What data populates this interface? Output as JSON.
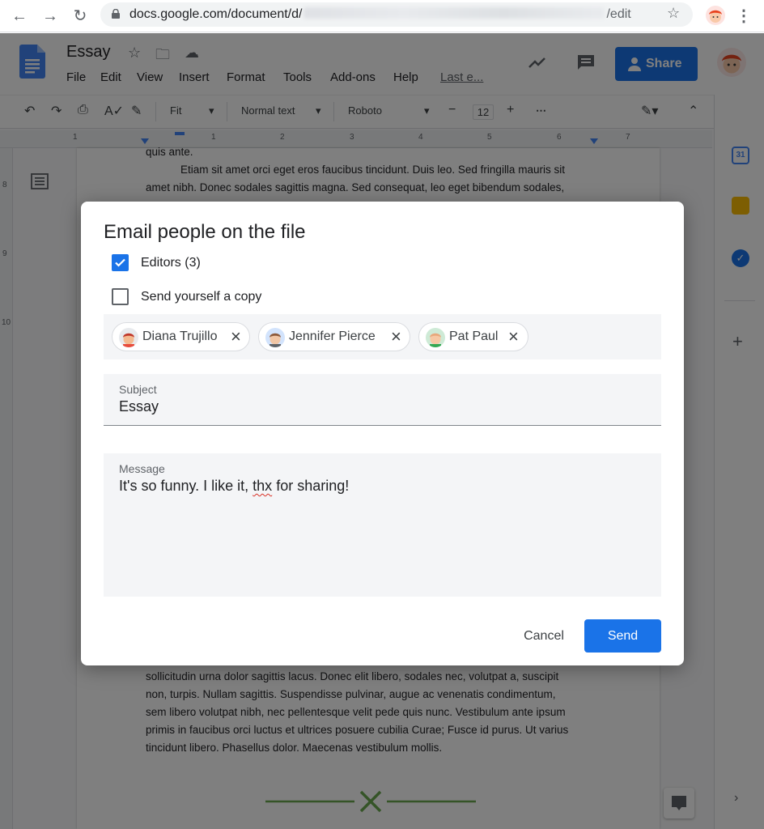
{
  "browser": {
    "url_prefix": "docs.google.com/document/d/",
    "url_suffix": "/edit",
    "back_icon": "arrow-left-icon",
    "forward_icon": "arrow-right-icon",
    "reload_icon": "reload-icon",
    "bookmark_icon": "star-icon",
    "menu_icon": "vertical-dots-icon"
  },
  "doc": {
    "title": "Essay",
    "menu": [
      "File",
      "Edit",
      "View",
      "Insert",
      "Format",
      "Tools",
      "Add-ons",
      "Help"
    ],
    "last_edit": "Last e...",
    "share_label": "Share",
    "toolbar": {
      "zoom": "Fit",
      "style": "Normal text",
      "font": "Roboto",
      "font_size": "12"
    },
    "ruler_numbers": [
      "1",
      "1",
      "2",
      "3",
      "4",
      "5",
      "6",
      "7"
    ],
    "vruler_numbers": [
      "8",
      "9",
      "10"
    ],
    "page_top": [
      "quis ante.",
      "Etiam sit amet orci eget eros faucibus tincidunt. Duis leo. Sed fringilla mauris sit",
      "amet nibh. Donec sodales sagittis magna. Sed consequat, leo eget bibendum sodales,"
    ],
    "page_bottom": [
      "sollicitudin urna dolor sagittis lacus. Donec elit libero, sodales nec, volutpat a, suscipit",
      "non, turpis. Nullam sagittis. Suspendisse pulvinar, augue ac venenatis condimentum,",
      "sem libero volutpat nibh, nec pellentesque velit pede quis nunc. Vestibulum ante ipsum",
      "primis in faucibus orci luctus et ultrices posuere cubilia Curae; Fusce id purus. Ut varius",
      "tincidunt libero. Phasellus dolor. Maecenas vestibulum mollis."
    ]
  },
  "dialog": {
    "title": "Email people on the file",
    "editors_label": "Editors (3)",
    "editors_checked": true,
    "copy_label": "Send yourself a copy",
    "copy_checked": false,
    "recipients": [
      "Diana Trujillo",
      "Jennifer Pierce",
      "Pat Paul"
    ],
    "subject_label": "Subject",
    "subject_value": "Essay",
    "message_label": "Message",
    "message_before": "It's so funny. I like it, ",
    "message_misspelled": "thx",
    "message_after": " for sharing!",
    "cancel_label": "Cancel",
    "send_label": "Send"
  },
  "colors": {
    "accent": "#1a73e8",
    "overlay": "rgba(0,0,0,0.5)"
  }
}
